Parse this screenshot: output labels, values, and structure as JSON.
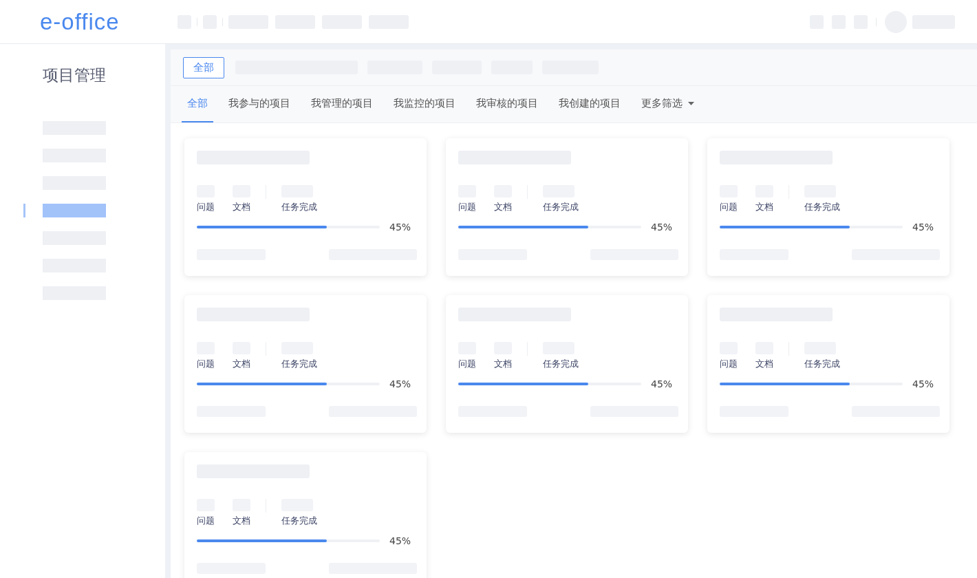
{
  "header": {
    "logo": "e-office"
  },
  "sidebar": {
    "title": "项目管理",
    "items": [
      {
        "selected": false
      },
      {
        "selected": false
      },
      {
        "selected": false
      },
      {
        "selected": true
      },
      {
        "selected": false
      },
      {
        "selected": false
      },
      {
        "selected": false
      }
    ]
  },
  "filter_bar": {
    "button": "全部"
  },
  "tabs": [
    {
      "label": "全部",
      "selected": true,
      "kind": "tab"
    },
    {
      "label": "我参与的项目",
      "selected": false,
      "kind": "tab"
    },
    {
      "label": "我管理的项目",
      "selected": false,
      "kind": "tab"
    },
    {
      "label": "我监控的项目",
      "selected": false,
      "kind": "tab"
    },
    {
      "label": "我审核的项目",
      "selected": false,
      "kind": "tab"
    },
    {
      "label": "我创建的项目",
      "selected": false,
      "kind": "tab"
    },
    {
      "label": "更多筛选",
      "selected": false,
      "kind": "dropdown"
    }
  ],
  "cards": [
    {
      "stats": [
        "问题",
        "文档",
        "任务完成"
      ],
      "level": 0.71,
      "reading": "45%"
    },
    {
      "stats": [
        "问题",
        "文档",
        "任务完成"
      ],
      "level": 0.71,
      "reading": "45%"
    },
    {
      "stats": [
        "问题",
        "文档",
        "任务完成"
      ],
      "level": 0.71,
      "reading": "45%"
    },
    {
      "stats": [
        "问题",
        "文档",
        "任务完成"
      ],
      "level": 0.71,
      "reading": "45%"
    },
    {
      "stats": [
        "问题",
        "文档",
        "任务完成"
      ],
      "level": 0.71,
      "reading": "45%"
    },
    {
      "stats": [
        "问题",
        "文档",
        "任务完成"
      ],
      "level": 0.71,
      "reading": "45%"
    },
    {
      "stats": [
        "问题",
        "文档",
        "任务完成"
      ],
      "level": 0.71,
      "reading": "45%"
    }
  ]
}
